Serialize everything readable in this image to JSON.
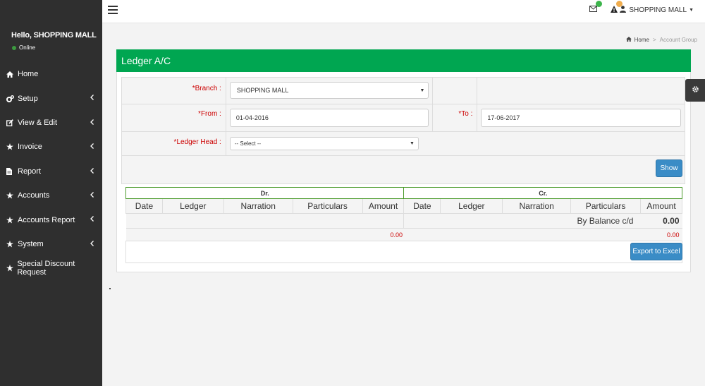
{
  "sidebar": {
    "user_name": "Hello, SHOPPING MALL",
    "status": "Online",
    "items": [
      {
        "label": "Home",
        "icon": "home-icon",
        "has_chevron": false
      },
      {
        "label": "Setup",
        "icon": "gears-icon",
        "has_chevron": true
      },
      {
        "label": "View & Edit",
        "icon": "edit-icon",
        "has_chevron": true
      },
      {
        "label": "Invoice",
        "icon": "star-icon",
        "has_chevron": true
      },
      {
        "label": "Report",
        "icon": "file-icon",
        "has_chevron": true
      },
      {
        "label": "Accounts",
        "icon": "star-icon",
        "has_chevron": true
      },
      {
        "label": "Accounts Report",
        "icon": "star-icon",
        "has_chevron": true
      },
      {
        "label": "System",
        "icon": "star-icon",
        "has_chevron": true
      },
      {
        "label": "Special Discount Request",
        "icon": "star-icon",
        "has_chevron": false
      }
    ]
  },
  "topbar": {
    "user": "SHOPPING MALL",
    "mail_badge_color": "#3cb44b",
    "alert_badge_color": "#f0ad4e"
  },
  "breadcrumb": {
    "home": "Home",
    "current": "Account Group"
  },
  "panel": {
    "title": "Ledger A/C",
    "header_color": "#00a651"
  },
  "form": {
    "branch_label": "*Branch :",
    "branch_value": "SHOPPING MALL",
    "from_label": "*From :",
    "from_value": "01-04-2016",
    "to_label": "*To :",
    "to_value": "17-06-2017",
    "ledger_head_label": "*Ledger Head :",
    "ledger_head_value": "-- Select --",
    "show_button": "Show"
  },
  "ledger": {
    "dr_label": "Dr.",
    "cr_label": "Cr.",
    "columns": [
      "Date",
      "Ledger",
      "Narration",
      "Particulars",
      "Amount"
    ],
    "balance_label": "By Balance c/d",
    "balance_value": "0.00",
    "dr_total": "0.00",
    "cr_total": "0.00",
    "export_button": "Export to Excel"
  }
}
